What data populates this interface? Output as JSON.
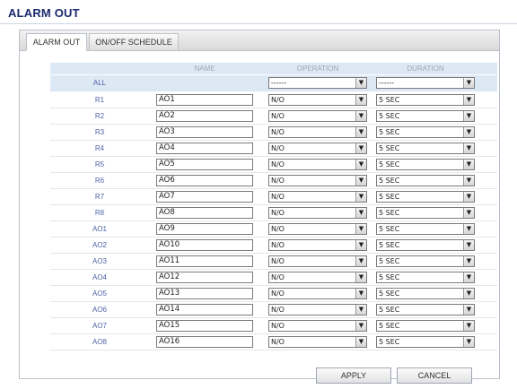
{
  "page": {
    "title": "ALARM OUT"
  },
  "tabs": [
    {
      "label": "ALARM OUT",
      "active": true
    },
    {
      "label": "ON/OFF SCHEDULE",
      "active": false
    }
  ],
  "columns": {
    "name": "NAME",
    "operation": "OPERATION",
    "duration": "DURATION"
  },
  "all_row": {
    "label": "ALL",
    "operation": "------",
    "duration": "------"
  },
  "rows": [
    {
      "label": "R1",
      "name": "AO1",
      "operation": "N/O",
      "duration": "5 SEC"
    },
    {
      "label": "R2",
      "name": "AO2",
      "operation": "N/O",
      "duration": "5 SEC"
    },
    {
      "label": "R3",
      "name": "AO3",
      "operation": "N/O",
      "duration": "5 SEC"
    },
    {
      "label": "R4",
      "name": "AO4",
      "operation": "N/O",
      "duration": "5 SEC"
    },
    {
      "label": "R5",
      "name": "AO5",
      "operation": "N/O",
      "duration": "5 SEC"
    },
    {
      "label": "R6",
      "name": "AO6",
      "operation": "N/O",
      "duration": "5 SEC"
    },
    {
      "label": "R7",
      "name": "AO7",
      "operation": "N/O",
      "duration": "5 SEC"
    },
    {
      "label": "R8",
      "name": "AO8",
      "operation": "N/O",
      "duration": "5 SEC"
    },
    {
      "label": "AO1",
      "name": "AO9",
      "operation": "N/O",
      "duration": "5 SEC"
    },
    {
      "label": "AO2",
      "name": "AO10",
      "operation": "N/O",
      "duration": "5 SEC"
    },
    {
      "label": "AO3",
      "name": "AO11",
      "operation": "N/O",
      "duration": "5 SEC"
    },
    {
      "label": "AO4",
      "name": "AO12",
      "operation": "N/O",
      "duration": "5 SEC"
    },
    {
      "label": "AO5",
      "name": "AO13",
      "operation": "N/O",
      "duration": "5 SEC"
    },
    {
      "label": "AO6",
      "name": "AO14",
      "operation": "N/O",
      "duration": "5 SEC"
    },
    {
      "label": "AO7",
      "name": "AO15",
      "operation": "N/O",
      "duration": "5 SEC"
    },
    {
      "label": "AO8",
      "name": "AO16",
      "operation": "N/O",
      "duration": "5 SEC"
    }
  ],
  "buttons": {
    "apply": "APPLY",
    "cancel": "CANCEL"
  },
  "icons": {
    "dropdown": "chevron-down-icon"
  },
  "colors": {
    "title": "#1a2a6e",
    "row_label": "#4d63a6",
    "header_bg": "#dde8f5"
  }
}
